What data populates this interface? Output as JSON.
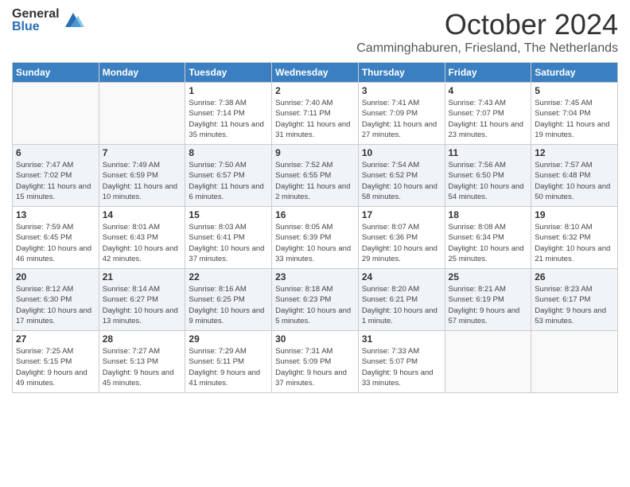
{
  "logo": {
    "general": "General",
    "blue": "Blue"
  },
  "header": {
    "month": "October 2024",
    "location": "Camminghaburen, Friesland, The Netherlands"
  },
  "weekdays": [
    "Sunday",
    "Monday",
    "Tuesday",
    "Wednesday",
    "Thursday",
    "Friday",
    "Saturday"
  ],
  "weeks": [
    [
      {
        "day": "",
        "info": ""
      },
      {
        "day": "",
        "info": ""
      },
      {
        "day": "1",
        "info": "Sunrise: 7:38 AM\nSunset: 7:14 PM\nDaylight: 11 hours and 35 minutes."
      },
      {
        "day": "2",
        "info": "Sunrise: 7:40 AM\nSunset: 7:11 PM\nDaylight: 11 hours and 31 minutes."
      },
      {
        "day": "3",
        "info": "Sunrise: 7:41 AM\nSunset: 7:09 PM\nDaylight: 11 hours and 27 minutes."
      },
      {
        "day": "4",
        "info": "Sunrise: 7:43 AM\nSunset: 7:07 PM\nDaylight: 11 hours and 23 minutes."
      },
      {
        "day": "5",
        "info": "Sunrise: 7:45 AM\nSunset: 7:04 PM\nDaylight: 11 hours and 19 minutes."
      }
    ],
    [
      {
        "day": "6",
        "info": "Sunrise: 7:47 AM\nSunset: 7:02 PM\nDaylight: 11 hours and 15 minutes."
      },
      {
        "day": "7",
        "info": "Sunrise: 7:49 AM\nSunset: 6:59 PM\nDaylight: 11 hours and 10 minutes."
      },
      {
        "day": "8",
        "info": "Sunrise: 7:50 AM\nSunset: 6:57 PM\nDaylight: 11 hours and 6 minutes."
      },
      {
        "day": "9",
        "info": "Sunrise: 7:52 AM\nSunset: 6:55 PM\nDaylight: 11 hours and 2 minutes."
      },
      {
        "day": "10",
        "info": "Sunrise: 7:54 AM\nSunset: 6:52 PM\nDaylight: 10 hours and 58 minutes."
      },
      {
        "day": "11",
        "info": "Sunrise: 7:56 AM\nSunset: 6:50 PM\nDaylight: 10 hours and 54 minutes."
      },
      {
        "day": "12",
        "info": "Sunrise: 7:57 AM\nSunset: 6:48 PM\nDaylight: 10 hours and 50 minutes."
      }
    ],
    [
      {
        "day": "13",
        "info": "Sunrise: 7:59 AM\nSunset: 6:45 PM\nDaylight: 10 hours and 46 minutes."
      },
      {
        "day": "14",
        "info": "Sunrise: 8:01 AM\nSunset: 6:43 PM\nDaylight: 10 hours and 42 minutes."
      },
      {
        "day": "15",
        "info": "Sunrise: 8:03 AM\nSunset: 6:41 PM\nDaylight: 10 hours and 37 minutes."
      },
      {
        "day": "16",
        "info": "Sunrise: 8:05 AM\nSunset: 6:39 PM\nDaylight: 10 hours and 33 minutes."
      },
      {
        "day": "17",
        "info": "Sunrise: 8:07 AM\nSunset: 6:36 PM\nDaylight: 10 hours and 29 minutes."
      },
      {
        "day": "18",
        "info": "Sunrise: 8:08 AM\nSunset: 6:34 PM\nDaylight: 10 hours and 25 minutes."
      },
      {
        "day": "19",
        "info": "Sunrise: 8:10 AM\nSunset: 6:32 PM\nDaylight: 10 hours and 21 minutes."
      }
    ],
    [
      {
        "day": "20",
        "info": "Sunrise: 8:12 AM\nSunset: 6:30 PM\nDaylight: 10 hours and 17 minutes."
      },
      {
        "day": "21",
        "info": "Sunrise: 8:14 AM\nSunset: 6:27 PM\nDaylight: 10 hours and 13 minutes."
      },
      {
        "day": "22",
        "info": "Sunrise: 8:16 AM\nSunset: 6:25 PM\nDaylight: 10 hours and 9 minutes."
      },
      {
        "day": "23",
        "info": "Sunrise: 8:18 AM\nSunset: 6:23 PM\nDaylight: 10 hours and 5 minutes."
      },
      {
        "day": "24",
        "info": "Sunrise: 8:20 AM\nSunset: 6:21 PM\nDaylight: 10 hours and 1 minute."
      },
      {
        "day": "25",
        "info": "Sunrise: 8:21 AM\nSunset: 6:19 PM\nDaylight: 9 hours and 57 minutes."
      },
      {
        "day": "26",
        "info": "Sunrise: 8:23 AM\nSunset: 6:17 PM\nDaylight: 9 hours and 53 minutes."
      }
    ],
    [
      {
        "day": "27",
        "info": "Sunrise: 7:25 AM\nSunset: 5:15 PM\nDaylight: 9 hours and 49 minutes."
      },
      {
        "day": "28",
        "info": "Sunrise: 7:27 AM\nSunset: 5:13 PM\nDaylight: 9 hours and 45 minutes."
      },
      {
        "day": "29",
        "info": "Sunrise: 7:29 AM\nSunset: 5:11 PM\nDaylight: 9 hours and 41 minutes."
      },
      {
        "day": "30",
        "info": "Sunrise: 7:31 AM\nSunset: 5:09 PM\nDaylight: 9 hours and 37 minutes."
      },
      {
        "day": "31",
        "info": "Sunrise: 7:33 AM\nSunset: 5:07 PM\nDaylight: 9 hours and 33 minutes."
      },
      {
        "day": "",
        "info": ""
      },
      {
        "day": "",
        "info": ""
      }
    ]
  ]
}
